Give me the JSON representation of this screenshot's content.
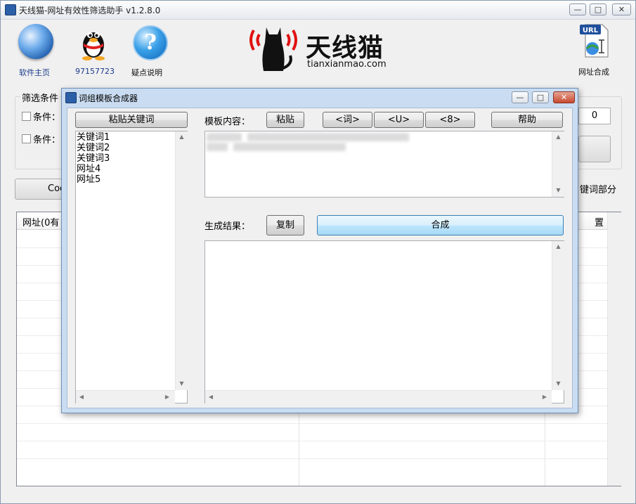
{
  "window": {
    "title": "天线猫-网址有效性筛选助手 v1.2.8.0"
  },
  "toolbar": {
    "home_label": "软件主页",
    "qq_label": "97157723",
    "help_label": "疑点说明",
    "url_merge_label": "网址合成",
    "url_badge": "URL"
  },
  "logo": {
    "text": "天线猫",
    "sub": "tianxianmao.com"
  },
  "background": {
    "filter_group_label": "筛选条件",
    "condition1_label": "条件：",
    "condition2_label": "条件：",
    "number_value": "0",
    "partial_button": "Coo",
    "keyword_part_label": "键词部分",
    "col_url": "网址(0有",
    "col_position": "置"
  },
  "dialog": {
    "title": "词组模板合成器",
    "paste_keywords_button": "粘贴关键词",
    "keywords": [
      "关键词1",
      "关键词2",
      "关键词3",
      "网址4",
      "网址5"
    ],
    "template_label": "模板内容：",
    "paste_button": "粘贴",
    "insert_word_button": "<词>",
    "insert_u_button": "<U>",
    "insert_8_button": "<8>",
    "help_button": "帮助",
    "result_label": "生成结果：",
    "copy_button": "复制",
    "compose_button": "合成"
  }
}
